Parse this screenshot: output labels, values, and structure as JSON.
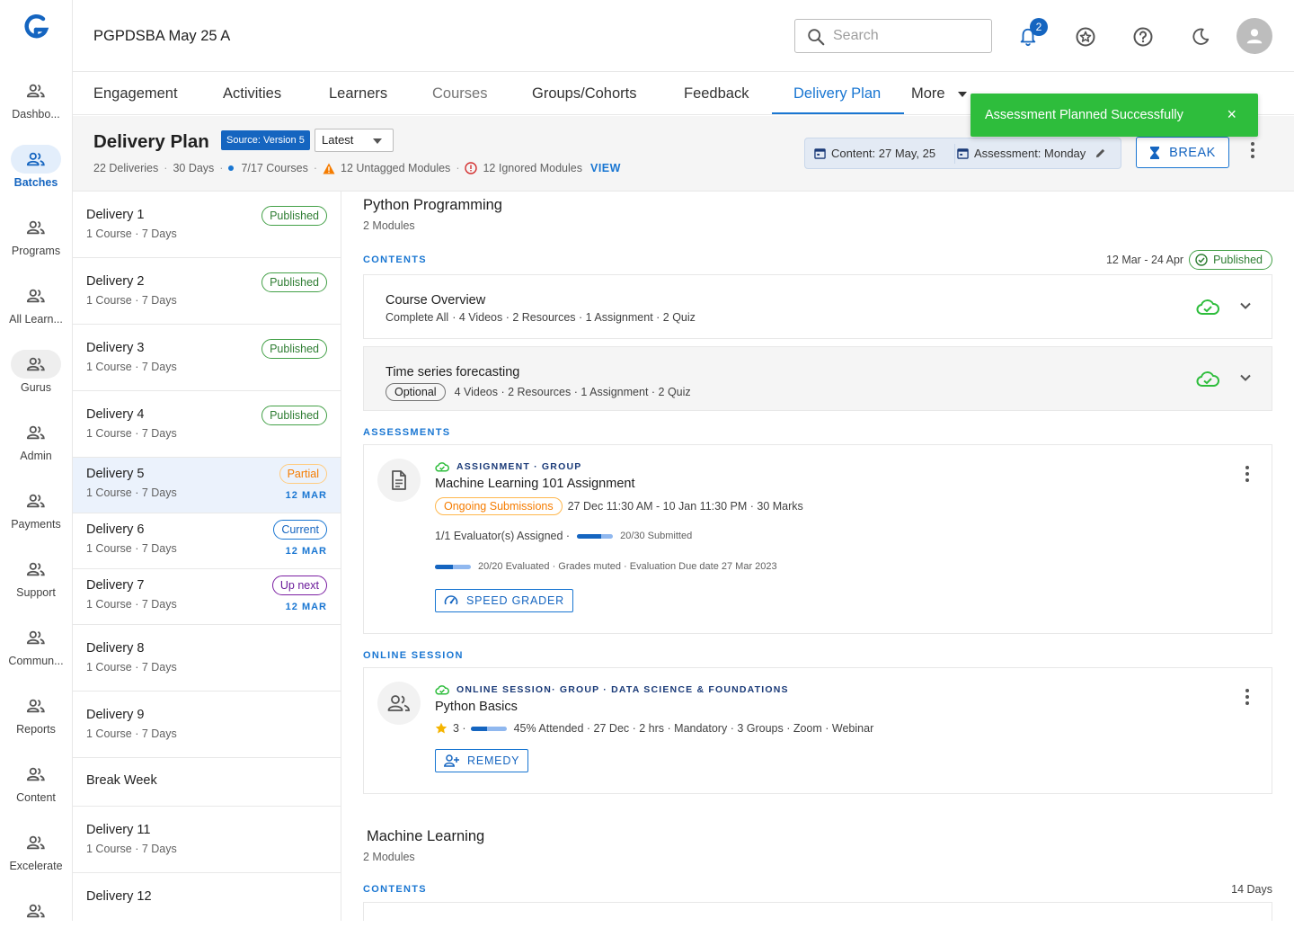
{
  "app": {
    "project_name": "PGPDSBA May 25 A"
  },
  "sidebar": {
    "items": [
      {
        "label": "Dashbo..."
      },
      {
        "label": "Batches",
        "active": true
      },
      {
        "label": "Programs"
      },
      {
        "label": "All Learn..."
      },
      {
        "label": "Gurus"
      },
      {
        "label": "Admin"
      },
      {
        "label": "Payments"
      },
      {
        "label": "Support"
      },
      {
        "label": "Commun..."
      },
      {
        "label": "Reports"
      },
      {
        "label": "Content"
      },
      {
        "label": "Excelerate"
      },
      {
        "label": ""
      }
    ]
  },
  "topbar": {
    "search_placeholder": "Search",
    "notification_count": "2",
    "icons": [
      "search-icon",
      "bell-icon",
      "star-badge-icon",
      "help-icon",
      "moon-icon",
      "user-icon"
    ]
  },
  "tabs": [
    {
      "label": "Engagement"
    },
    {
      "label": "Activities"
    },
    {
      "label": "Learners"
    },
    {
      "label": "Courses"
    },
    {
      "label": "Groups/Cohorts"
    },
    {
      "label": "Feedback"
    },
    {
      "label": "Delivery Plan"
    },
    {
      "label": "More"
    }
  ],
  "toast": {
    "message": "Assessment Planned Successfully",
    "close": "×",
    "color": "#2ebd3c"
  },
  "delivery_plan": {
    "title": "Delivery Plan",
    "source_badge": "Source: Version 5",
    "version_select": "Latest",
    "meta": {
      "deliveries": "22 Deliveries",
      "days": "30 Days",
      "courses": "7/17 Courses",
      "untagged": "12 Untagged Modules",
      "ignored": "12 Ignored Modules",
      "view": "VIEW"
    },
    "content_date": "Content: 27 May, 25",
    "assessment_day": "Assessment: Monday",
    "break_label": "BREAK"
  },
  "deliveries": [
    {
      "name": "Delivery 1",
      "sub": "1 Course · 7 Days",
      "status": "Published",
      "date": ""
    },
    {
      "name": "Delivery 2",
      "sub": "1 Course · 7 Days",
      "status": "Published",
      "date": ""
    },
    {
      "name": "Delivery 3",
      "sub": "1 Course · 7 Days",
      "status": "Published",
      "date": ""
    },
    {
      "name": "Delivery 4",
      "sub": "1 Course · 7 Days",
      "status": "Published",
      "date": ""
    },
    {
      "name": "Delivery 5",
      "sub": "1 Course · 7 Days",
      "status": "Partial",
      "date": "12 MAR"
    },
    {
      "name": "Delivery 6",
      "sub": "1 Course · 7 Days",
      "status": "Current",
      "date": "12 MAR"
    },
    {
      "name": "Delivery 7",
      "sub": "1 Course · 7 Days",
      "status": "Up next",
      "date": "12 MAR"
    },
    {
      "name": "Delivery 8",
      "sub": "1 Course · 7 Days",
      "status": "",
      "date": ""
    },
    {
      "name": "Delivery 9",
      "sub": "1 Course · 7 Days",
      "status": "",
      "date": ""
    },
    {
      "name": "Break Week",
      "sub": "",
      "status": "",
      "date": ""
    },
    {
      "name": "Delivery 11",
      "sub": "1 Course · 7 Days",
      "status": "",
      "date": ""
    },
    {
      "name": "Delivery 12",
      "sub": "",
      "status": "",
      "date": ""
    }
  ],
  "course1": {
    "title": "Python Programming",
    "modules": "2 Modules",
    "contents_label": "CONTENTS",
    "date_range": "12 Mar - 24 Apr",
    "status": "Published",
    "modules_list": [
      {
        "title": "Course Overview",
        "prefix": "Complete All",
        "details": "· 4 Videos  · 2 Resources · 1 Assignment · 2 Quiz"
      },
      {
        "title": "Time series forecasting",
        "chip": "Optional",
        "details": "4 Videos  · 2 Resources · 1 Assignment · 2 Quiz"
      }
    ],
    "assessments_label": "ASSESSMENTS",
    "assignment": {
      "type": "ASSIGNMENT · GROUP",
      "title": "Machine Learning 101 Assignment",
      "status": "Ongoing Submissions",
      "schedule": "27 Dec 11:30 AM - 10 Jan 11:30 PM · 30 Marks",
      "evaluators": "1/1 Evaluator(s) Assigned ·",
      "submitted": "20/30 Submitted",
      "submitted_progress": 0.67,
      "evaluated": "20/20 Evaluated · Grades muted · Evaluation Due date 27 Mar 2023",
      "evaluated_progress": 0.5,
      "button": "SPEED GRADER"
    },
    "online_label": "ONLINE SESSION",
    "session": {
      "type": "ONLINE SESSION· GROUP · DATA SCIENCE & FOUNDATIONS",
      "title": "Python Basics",
      "rating": "3 ·",
      "attended_progress": 0.45,
      "details": "45% Attended · 27 Dec · 2 hrs · Mandatory · 3 Groups · Zoom · Webinar",
      "button": "REMEDY"
    }
  },
  "course2": {
    "title": "Machine Learning",
    "modules": "2 Modules",
    "contents_label": "CONTENTS",
    "duration": "14 Days"
  }
}
